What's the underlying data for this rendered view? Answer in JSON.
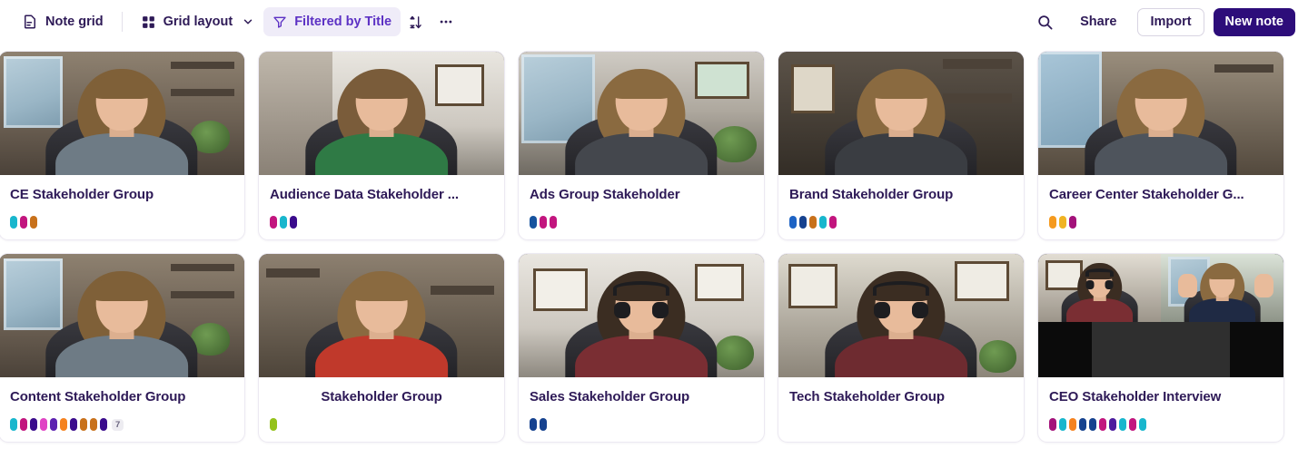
{
  "toolbar": {
    "note_grid_label": "Note grid",
    "note_grid_icon": "document-icon",
    "layout_label": "Grid layout",
    "layout_icon": "grid-icon",
    "layout_chevron_icon": "chevron-down-icon",
    "filter_label": "Filtered by Title",
    "filter_icon": "funnel-icon",
    "sort_icon": "sort-az-icon",
    "more_icon": "more-horizontal-icon",
    "search_icon": "search-icon",
    "share_label": "Share",
    "import_label": "Import",
    "new_note_label": "New note",
    "accent_color": "#5c31c4",
    "primary_button_color": "#2d0d7a",
    "active_chip_bg": "#efecf8"
  },
  "cards": [
    {
      "title": "CE Stakeholder Group",
      "title_align": "left",
      "scene": "woman-room-left",
      "pills": [
        "#18b6cd",
        "#c2157e",
        "#c8711b"
      ],
      "more": null
    },
    {
      "title": "Audience Data Stakeholder ...",
      "title_align": "left",
      "scene": "woman-green-shirt",
      "pills": [
        "#c2157e",
        "#18b6cd",
        "#3a0b8c"
      ],
      "more": null
    },
    {
      "title": "Ads Group Stakeholder",
      "title_align": "left",
      "scene": "woman-bright-room",
      "pills": [
        "#16539e",
        "#c2157e",
        "#c2157e"
      ],
      "more": null
    },
    {
      "title": "Brand Stakeholder Group",
      "title_align": "left",
      "scene": "woman-dark-room",
      "pills": [
        "#1d63c4",
        "#16428f",
        "#c8711b",
        "#18b6cd",
        "#c2157e"
      ],
      "more": null
    },
    {
      "title": "Career Center Stakeholder G...",
      "title_align": "left",
      "scene": "woman-window-left",
      "pills": [
        "#f59a1e",
        "#f0b323",
        "#a3127a"
      ],
      "more": null
    },
    {
      "title": "Content Stakeholder Group",
      "title_align": "left",
      "scene": "woman-room-left",
      "pills": [
        "#18b6cd",
        "#c2157e",
        "#3a0b8c",
        "#e043c4",
        "#5c21b0",
        "#f5821f",
        "#3a0b8c",
        "#c8711b",
        "#c8711b",
        "#3a0b8c"
      ],
      "more": "7"
    },
    {
      "title": "Stakeholder Group",
      "title_align": "center",
      "scene": "woman-red-shirt",
      "pills": [
        "#94c21a"
      ],
      "more": null
    },
    {
      "title": "Sales Stakeholder Group",
      "title_align": "left",
      "scene": "man-headset-light",
      "pills": [
        "#16428f",
        "#16428f"
      ],
      "more": null
    },
    {
      "title": "Tech Stakeholder Group",
      "title_align": "left",
      "scene": "man-headset-dark",
      "pills": [],
      "more": null
    },
    {
      "title": "CEO Stakeholder Interview",
      "title_align": "left",
      "scene": "two-person-split",
      "pills": [
        "#a3127a",
        "#18b6cd",
        "#f5821f",
        "#16428f",
        "#16428f",
        "#c2157e",
        "#4b1c9e",
        "#18b6cd",
        "#c2157e",
        "#18b6cd"
      ],
      "more": null
    }
  ]
}
